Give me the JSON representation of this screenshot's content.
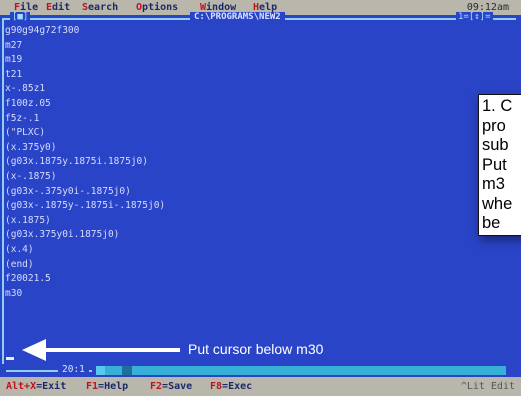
{
  "menubar": {
    "items": [
      {
        "hot": "F",
        "rest": "ile"
      },
      {
        "hot": "E",
        "rest": "dit"
      },
      {
        "hot": "S",
        "rest": "earch"
      },
      {
        "hot": "O",
        "rest": "ptions"
      },
      {
        "hot": "W",
        "rest": "indow"
      },
      {
        "hot": "H",
        "rest": "elp"
      }
    ],
    "clock": "09:12am"
  },
  "window": {
    "close_button": "[■]",
    "title": "C:\\PROGRAMS\\NEW2",
    "controls": "1=[↕]="
  },
  "editor": {
    "lines": [
      "g90g94g72f300",
      "m27",
      "m19",
      "t21",
      "x-.85z1",
      "f100z.05",
      "f5z-.1",
      "(\"PLXC)",
      "(x.375y0)",
      "(g03x.1875y.1875i.1875j0)",
      "(x-.1875)",
      "(g03x-.375y0i-.1875j0)",
      "(g03x-.1875y-.1875i-.1875j0)",
      "(x.1875)",
      "(g03x.375y0i.1875j0)",
      "(x.4)",
      "(end)",
      "f20021.5",
      "m30"
    ],
    "line_col": "20:1"
  },
  "statusbar": {
    "keys": [
      {
        "key": "Alt+X",
        "label": "=Exit"
      },
      {
        "key": "F1",
        "label": "=Help"
      },
      {
        "key": "F2",
        "label": "=Save"
      },
      {
        "key": "F8",
        "label": "=Exec"
      }
    ],
    "mode": "^Lit Edit"
  },
  "annotations": {
    "callout_text": "1. C\npro\nsub\nPut\nm3\nwhe\nbe",
    "arrow_label": "Put cursor below m30",
    "arrow_color": "#ffffff"
  }
}
